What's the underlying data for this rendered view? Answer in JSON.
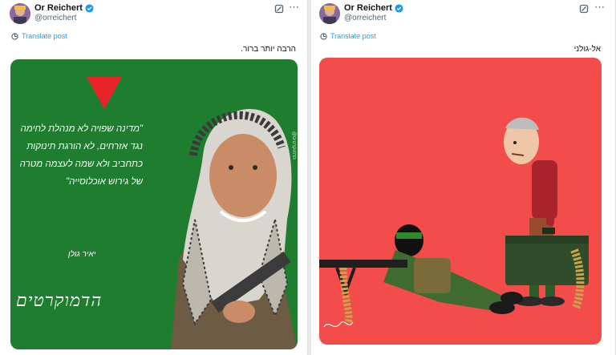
{
  "posts": [
    {
      "author": "Or Reichert",
      "handle": "@orreichert",
      "translate": "Translate post",
      "text": "הרבה יותר ברור.",
      "media": {
        "quote": "\"מדינה שפויה לא מנהלת לחימה נגד אזרחים, לא הורגת תינוקות כתחביב ולא שמה לעצמה מטרה של גירוש אוכלוסייה\"",
        "signature": "יאיר גולן",
        "brand": "הדמוקרטים",
        "side_credit": "@הדמוקרטים"
      }
    },
    {
      "author": "Or Reichert",
      "handle": "@orreichert",
      "translate": "Translate post",
      "text": "אל-גולני"
    }
  ],
  "colors": {
    "verified": "#1d9bf0",
    "link": "#1d9bf0",
    "green_bg": "#1e7d2e",
    "red_bg": "#f24d4a",
    "triangle": "#e8232a"
  },
  "icons": [
    "grok-icon",
    "more-icon",
    "translate-icon",
    "verified-badge-icon"
  ]
}
